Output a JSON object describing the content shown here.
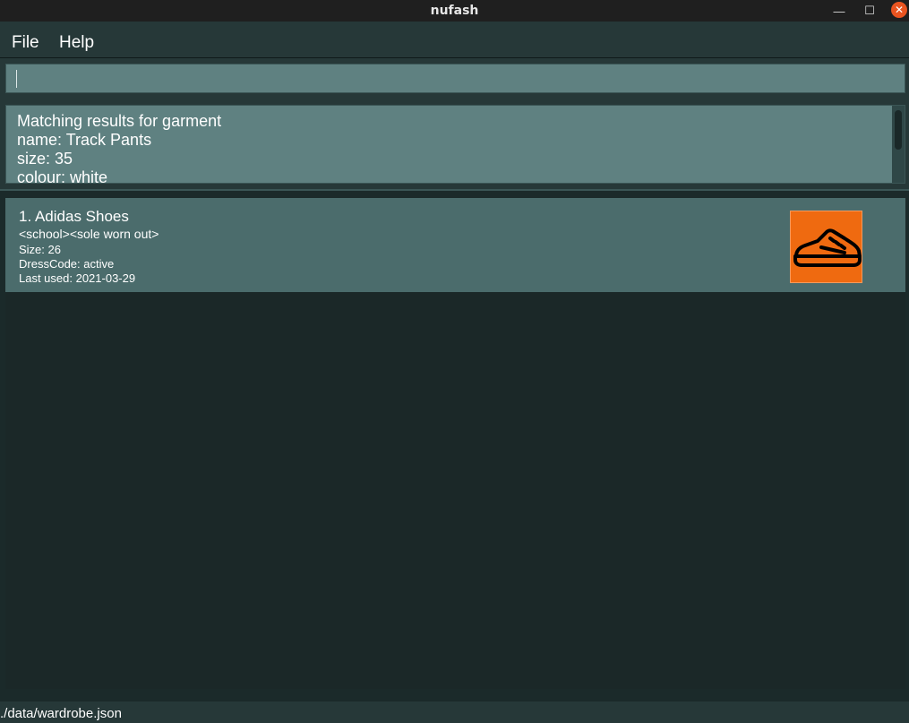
{
  "window": {
    "title": "nufash",
    "minimize_glyph": "—",
    "maximize_glyph": "☐",
    "close_glyph": "✕"
  },
  "menu": {
    "file_label": "File",
    "help_label": "Help"
  },
  "command": {
    "value": ""
  },
  "result": {
    "lines": [
      "Matching results for garment",
      "name: Track Pants",
      "size: 35",
      "colour: white"
    ]
  },
  "garments": [
    {
      "title": "1.  Adidas Shoes",
      "tags": "<school><sole worn out>",
      "size": "Size: 26",
      "dresscode": "DressCode: active",
      "last_used": "Last used: 2021-03-29",
      "icon": "shoe-icon"
    }
  ],
  "status": {
    "path": "./data/wardrobe.json"
  },
  "colors": {
    "accent": "#ef6a10",
    "background": "#1b2a2a",
    "panel": "#5f8181",
    "card": "#4b6c6c",
    "close_button": "#e95420"
  }
}
